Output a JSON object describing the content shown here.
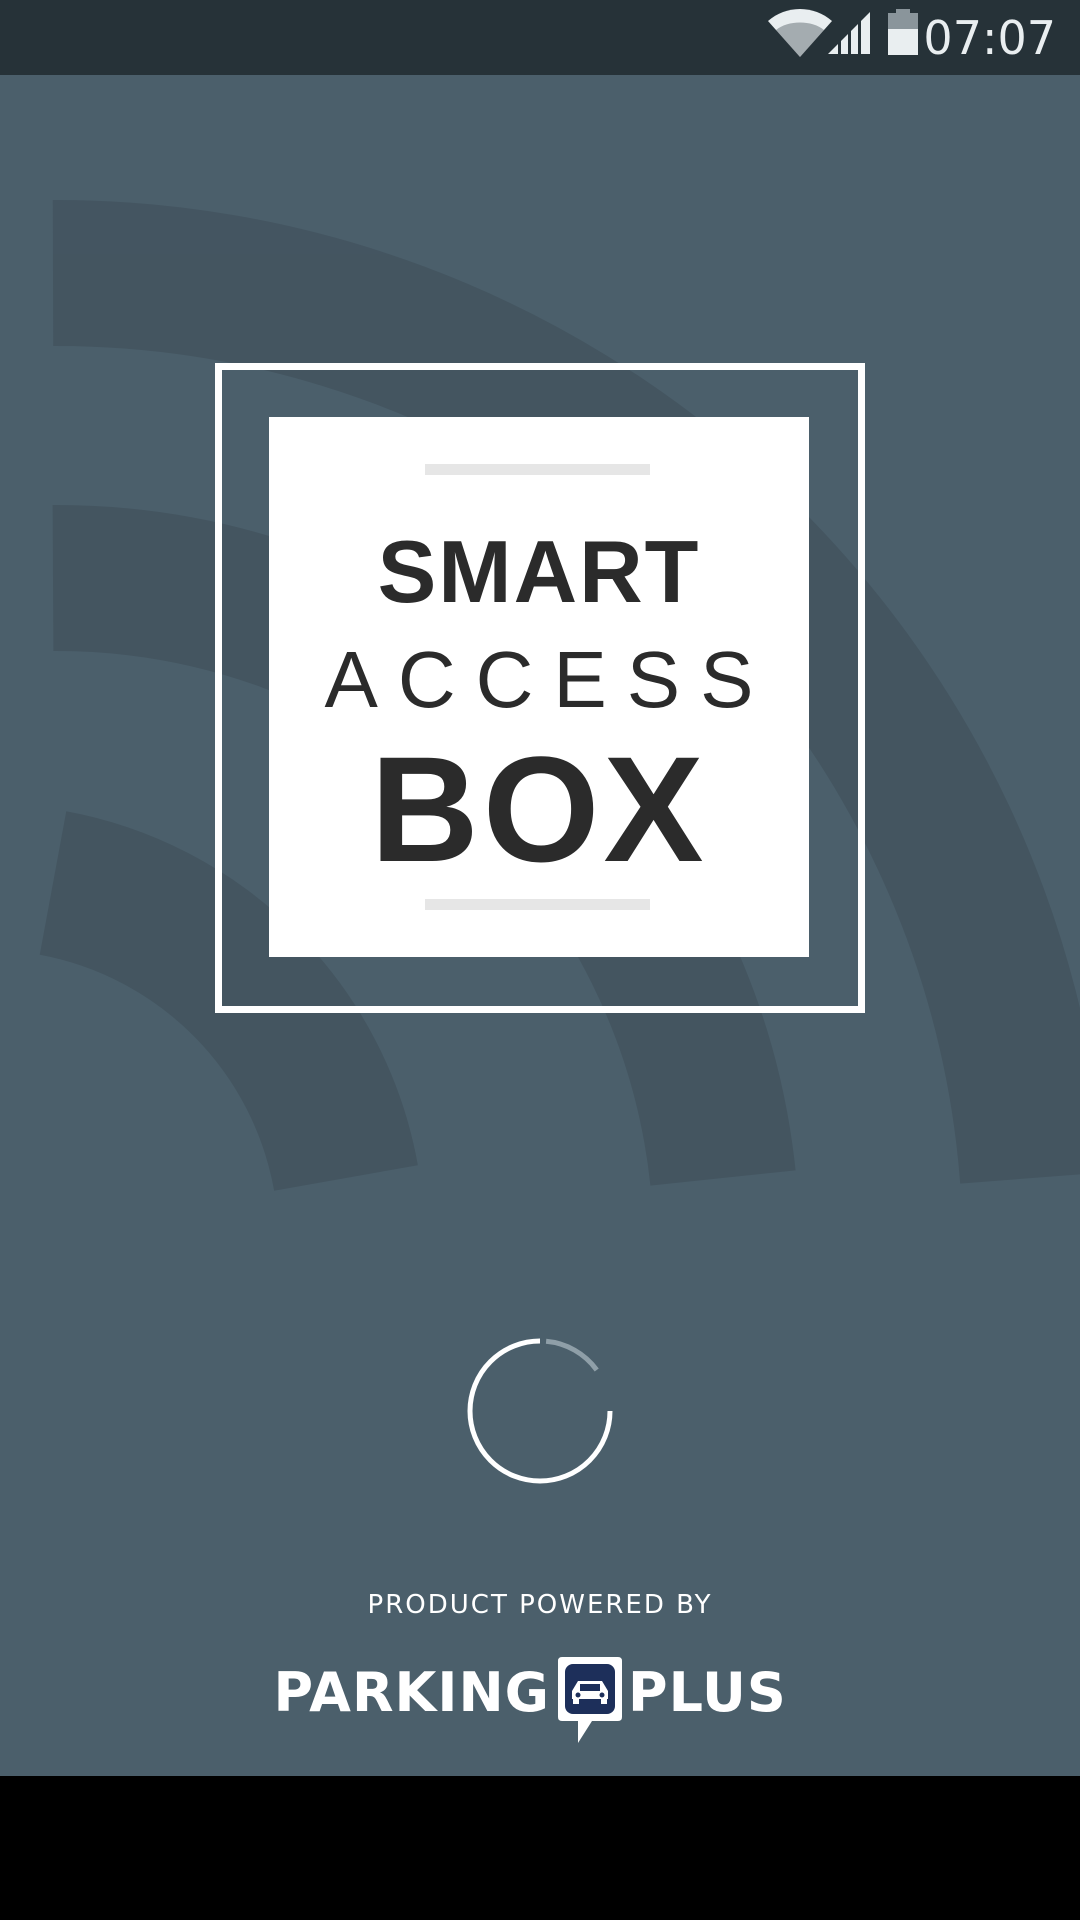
{
  "status_bar": {
    "time": "07:07",
    "icons": [
      "wifi-icon",
      "signal-icon",
      "battery-icon"
    ]
  },
  "logo": {
    "line1": "SMART",
    "line2": "ACCESS",
    "line3": "BOX"
  },
  "loading": {
    "state": "loading",
    "icon": "loading-spinner-icon"
  },
  "footer": {
    "powered_by": "PRODUCT POWERED BY",
    "brand_part1": "PARKING",
    "brand_part2": "PLUS",
    "brand_icon": "car-badge-icon"
  },
  "colors": {
    "background": "#4b5f6b",
    "status_bar": "#263238",
    "logo_text": "#2b2b2b",
    "brand_badge": "#1d2f5a",
    "white": "#ffffff"
  }
}
